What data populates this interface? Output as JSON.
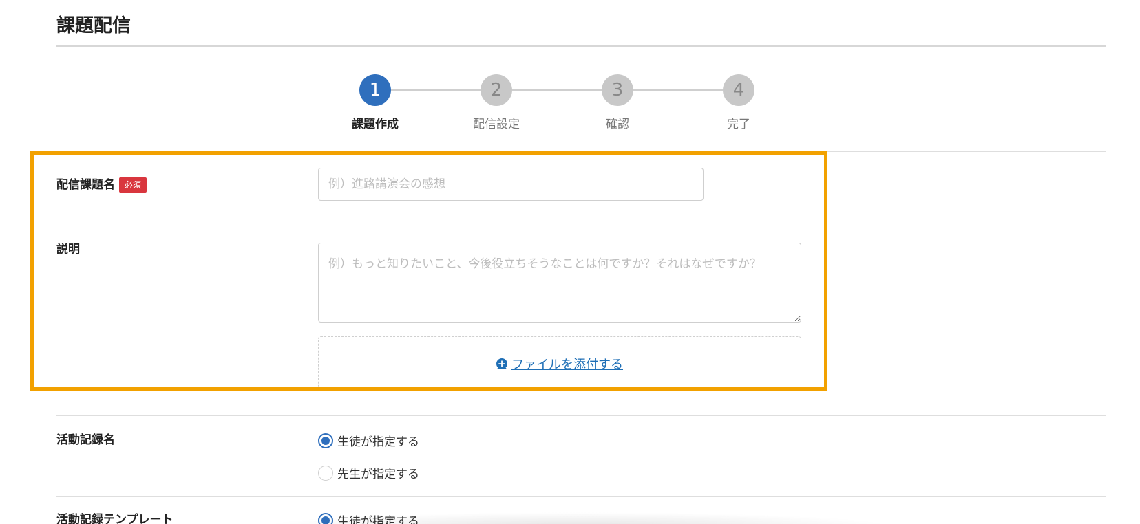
{
  "page": {
    "title": "課題配信"
  },
  "stepper": {
    "steps": [
      {
        "number": "1",
        "label": "課題作成",
        "active": true
      },
      {
        "number": "2",
        "label": "配信設定",
        "active": false
      },
      {
        "number": "3",
        "label": "確認",
        "active": false
      },
      {
        "number": "4",
        "label": "完了",
        "active": false
      }
    ]
  },
  "form": {
    "task_name": {
      "label": "配信課題名",
      "required_badge": "必須",
      "value": "",
      "placeholder": "例）進路講演会の感想"
    },
    "description": {
      "label": "説明",
      "value": "",
      "placeholder": "例）もっと知りたいこと、今後役立ちそうなことは何ですか？それはなぜですか？"
    },
    "attachment": {
      "link_label": "ファイルを添付する"
    },
    "activity_record_name": {
      "label": "活動記録名",
      "options": [
        {
          "label": "生徒が指定する",
          "checked": true
        },
        {
          "label": "先生が指定する",
          "checked": false
        }
      ]
    },
    "activity_record_template": {
      "label": "活動記録テンプレート",
      "options": [
        {
          "label": "生徒が指定する",
          "checked": true
        }
      ]
    }
  },
  "colors": {
    "accent": "#2f6fbd",
    "highlight": "#f2a100",
    "required": "#d9363e",
    "link": "#1f6fb6"
  }
}
